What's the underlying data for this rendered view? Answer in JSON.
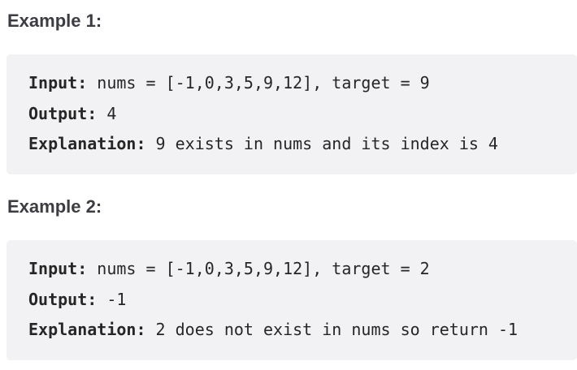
{
  "examples": [
    {
      "heading": "Example 1:",
      "input_label": "Input:",
      "input_value": " nums = [-1,0,3,5,9,12], target = 9",
      "output_label": "Output:",
      "output_value": " 4",
      "explanation_label": "Explanation:",
      "explanation_value": " 9 exists in nums and its index is 4"
    },
    {
      "heading": "Example 2:",
      "input_label": "Input:",
      "input_value": " nums = [-1,0,3,5,9,12], target = 2",
      "output_label": "Output:",
      "output_value": " -1",
      "explanation_label": "Explanation:",
      "explanation_value": " 2 does not exist in nums so return -1"
    }
  ]
}
